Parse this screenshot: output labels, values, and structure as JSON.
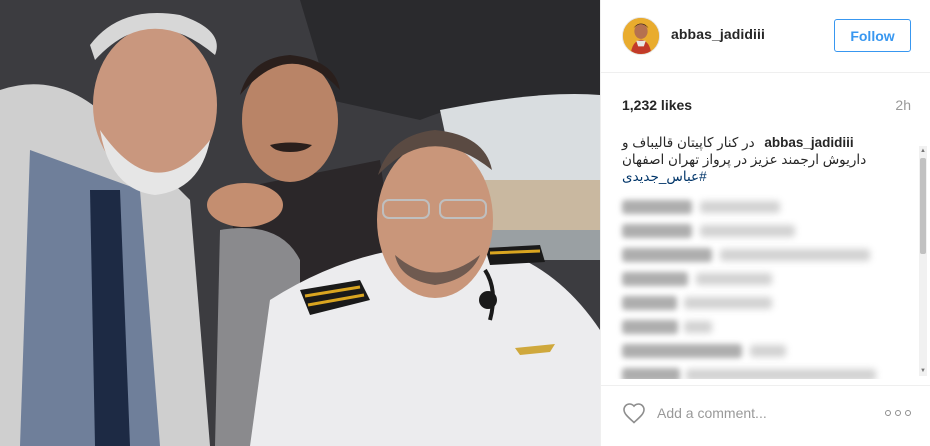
{
  "post": {
    "username": "abbas_jadidiii",
    "follow_label": "Follow",
    "likes": "1,232 likes",
    "time": "2h",
    "caption": {
      "user": "abbas_jadidiii",
      "text": "در کنار کاپیتان قالیباف و داریوش ارجمند عزیز در پرواز تهران اصفهان",
      "hashtag": "#عباس_جدیدی"
    },
    "comment_placeholder": "Add a comment..."
  },
  "icons": {
    "heart": "heart-icon",
    "more": "more-options-icon",
    "avatar": "profile-avatar"
  },
  "colors": {
    "accent": "#3897f0",
    "hashtag": "#003569",
    "muted": "#999999",
    "border": "#efefef"
  }
}
